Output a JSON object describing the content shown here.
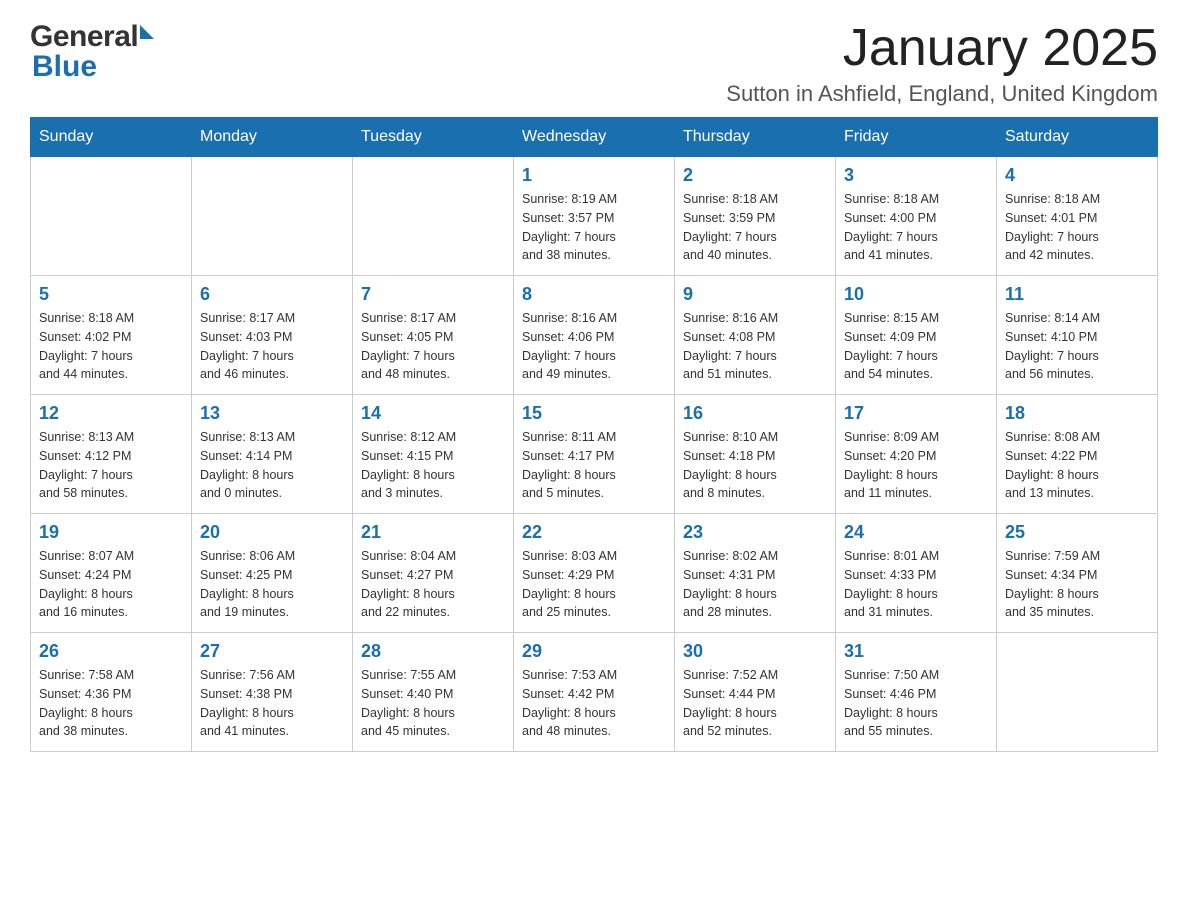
{
  "header": {
    "logo_general": "General",
    "logo_blue": "Blue",
    "month_title": "January 2025",
    "location": "Sutton in Ashfield, England, United Kingdom"
  },
  "days_of_week": [
    "Sunday",
    "Monday",
    "Tuesday",
    "Wednesday",
    "Thursday",
    "Friday",
    "Saturday"
  ],
  "weeks": [
    [
      {
        "day": "",
        "info": ""
      },
      {
        "day": "",
        "info": ""
      },
      {
        "day": "",
        "info": ""
      },
      {
        "day": "1",
        "info": "Sunrise: 8:19 AM\nSunset: 3:57 PM\nDaylight: 7 hours\nand 38 minutes."
      },
      {
        "day": "2",
        "info": "Sunrise: 8:18 AM\nSunset: 3:59 PM\nDaylight: 7 hours\nand 40 minutes."
      },
      {
        "day": "3",
        "info": "Sunrise: 8:18 AM\nSunset: 4:00 PM\nDaylight: 7 hours\nand 41 minutes."
      },
      {
        "day": "4",
        "info": "Sunrise: 8:18 AM\nSunset: 4:01 PM\nDaylight: 7 hours\nand 42 minutes."
      }
    ],
    [
      {
        "day": "5",
        "info": "Sunrise: 8:18 AM\nSunset: 4:02 PM\nDaylight: 7 hours\nand 44 minutes."
      },
      {
        "day": "6",
        "info": "Sunrise: 8:17 AM\nSunset: 4:03 PM\nDaylight: 7 hours\nand 46 minutes."
      },
      {
        "day": "7",
        "info": "Sunrise: 8:17 AM\nSunset: 4:05 PM\nDaylight: 7 hours\nand 48 minutes."
      },
      {
        "day": "8",
        "info": "Sunrise: 8:16 AM\nSunset: 4:06 PM\nDaylight: 7 hours\nand 49 minutes."
      },
      {
        "day": "9",
        "info": "Sunrise: 8:16 AM\nSunset: 4:08 PM\nDaylight: 7 hours\nand 51 minutes."
      },
      {
        "day": "10",
        "info": "Sunrise: 8:15 AM\nSunset: 4:09 PM\nDaylight: 7 hours\nand 54 minutes."
      },
      {
        "day": "11",
        "info": "Sunrise: 8:14 AM\nSunset: 4:10 PM\nDaylight: 7 hours\nand 56 minutes."
      }
    ],
    [
      {
        "day": "12",
        "info": "Sunrise: 8:13 AM\nSunset: 4:12 PM\nDaylight: 7 hours\nand 58 minutes."
      },
      {
        "day": "13",
        "info": "Sunrise: 8:13 AM\nSunset: 4:14 PM\nDaylight: 8 hours\nand 0 minutes."
      },
      {
        "day": "14",
        "info": "Sunrise: 8:12 AM\nSunset: 4:15 PM\nDaylight: 8 hours\nand 3 minutes."
      },
      {
        "day": "15",
        "info": "Sunrise: 8:11 AM\nSunset: 4:17 PM\nDaylight: 8 hours\nand 5 minutes."
      },
      {
        "day": "16",
        "info": "Sunrise: 8:10 AM\nSunset: 4:18 PM\nDaylight: 8 hours\nand 8 minutes."
      },
      {
        "day": "17",
        "info": "Sunrise: 8:09 AM\nSunset: 4:20 PM\nDaylight: 8 hours\nand 11 minutes."
      },
      {
        "day": "18",
        "info": "Sunrise: 8:08 AM\nSunset: 4:22 PM\nDaylight: 8 hours\nand 13 minutes."
      }
    ],
    [
      {
        "day": "19",
        "info": "Sunrise: 8:07 AM\nSunset: 4:24 PM\nDaylight: 8 hours\nand 16 minutes."
      },
      {
        "day": "20",
        "info": "Sunrise: 8:06 AM\nSunset: 4:25 PM\nDaylight: 8 hours\nand 19 minutes."
      },
      {
        "day": "21",
        "info": "Sunrise: 8:04 AM\nSunset: 4:27 PM\nDaylight: 8 hours\nand 22 minutes."
      },
      {
        "day": "22",
        "info": "Sunrise: 8:03 AM\nSunset: 4:29 PM\nDaylight: 8 hours\nand 25 minutes."
      },
      {
        "day": "23",
        "info": "Sunrise: 8:02 AM\nSunset: 4:31 PM\nDaylight: 8 hours\nand 28 minutes."
      },
      {
        "day": "24",
        "info": "Sunrise: 8:01 AM\nSunset: 4:33 PM\nDaylight: 8 hours\nand 31 minutes."
      },
      {
        "day": "25",
        "info": "Sunrise: 7:59 AM\nSunset: 4:34 PM\nDaylight: 8 hours\nand 35 minutes."
      }
    ],
    [
      {
        "day": "26",
        "info": "Sunrise: 7:58 AM\nSunset: 4:36 PM\nDaylight: 8 hours\nand 38 minutes."
      },
      {
        "day": "27",
        "info": "Sunrise: 7:56 AM\nSunset: 4:38 PM\nDaylight: 8 hours\nand 41 minutes."
      },
      {
        "day": "28",
        "info": "Sunrise: 7:55 AM\nSunset: 4:40 PM\nDaylight: 8 hours\nand 45 minutes."
      },
      {
        "day": "29",
        "info": "Sunrise: 7:53 AM\nSunset: 4:42 PM\nDaylight: 8 hours\nand 48 minutes."
      },
      {
        "day": "30",
        "info": "Sunrise: 7:52 AM\nSunset: 4:44 PM\nDaylight: 8 hours\nand 52 minutes."
      },
      {
        "day": "31",
        "info": "Sunrise: 7:50 AM\nSunset: 4:46 PM\nDaylight: 8 hours\nand 55 minutes."
      },
      {
        "day": "",
        "info": ""
      }
    ]
  ]
}
